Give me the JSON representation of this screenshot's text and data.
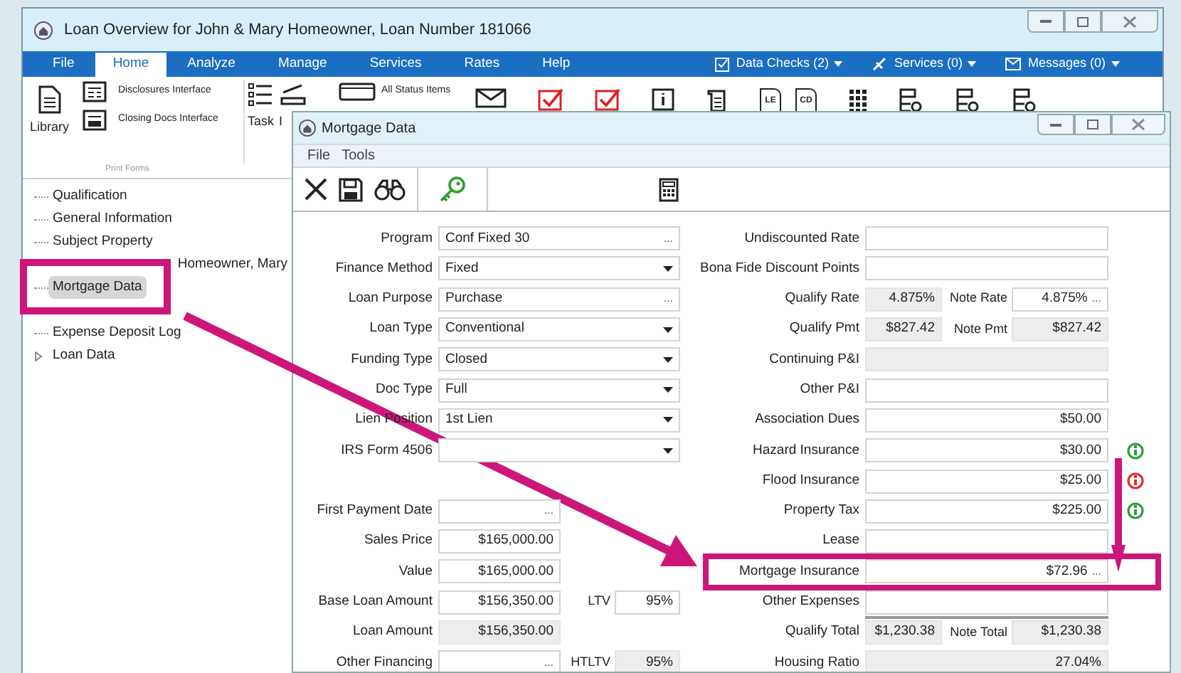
{
  "main_window": {
    "title": "Loan Overview for John & Mary Homeowner, Loan Number 181066"
  },
  "ribbon_tabs": [
    {
      "label": "File",
      "selected": false
    },
    {
      "label": "Home",
      "selected": true
    },
    {
      "label": "Analyze",
      "selected": false
    },
    {
      "label": "Manage",
      "selected": false
    },
    {
      "label": "Services",
      "selected": false
    },
    {
      "label": "Rates",
      "selected": false
    },
    {
      "label": "Help",
      "selected": false
    }
  ],
  "ribbon_menus": [
    {
      "kind": "checks",
      "label": "Data Checks (2)"
    },
    {
      "kind": "services",
      "label": "Services (0)"
    },
    {
      "kind": "messages",
      "label": "Messages (0)"
    }
  ],
  "ribbon": {
    "library": "Library",
    "disclosures": "Disclosures Interface",
    "closing_docs": "Closing Docs Interface",
    "group_label": "Print Forms",
    "task": "Task",
    "partial_label": "I",
    "status_items": "All Status Items",
    "doc_badges": [
      "LE",
      "CD"
    ]
  },
  "tree": [
    {
      "label": "Qualification",
      "selected": false
    },
    {
      "label": "General Information",
      "selected": false
    },
    {
      "label": "Subject Property",
      "selected": false
    },
    {
      "label": "Homeowner, Mary",
      "selected": false
    },
    {
      "label": "Mortgage Data",
      "selected": true
    },
    {
      "label": "Expense Deposit Log",
      "selected": false
    },
    {
      "label": "Loan Data",
      "selected": false,
      "expander": true
    }
  ],
  "mortgage_window": {
    "title": "Mortgage Data",
    "menu": [
      "File",
      "Tools"
    ]
  },
  "left_upper": [
    {
      "label": "Program",
      "value": "Conf Fixed 30",
      "kind": "picker",
      "button": "..."
    },
    {
      "label": "Finance Method",
      "value": "Fixed",
      "kind": "dropdown"
    },
    {
      "label": "Loan Purpose",
      "value": "Purchase",
      "kind": "picker",
      "button": "..."
    },
    {
      "label": "Loan Type",
      "value": "Conventional",
      "kind": "dropdown"
    },
    {
      "label": "Funding Type",
      "value": "Closed",
      "kind": "dropdown"
    },
    {
      "label": "Doc Type",
      "value": "Full",
      "kind": "dropdown"
    },
    {
      "label": "Lien Position",
      "value": "1st Lien",
      "kind": "dropdown"
    },
    {
      "label": "IRS Form 4506",
      "kind": "dropdown"
    }
  ],
  "left_lower": [
    {
      "label": "First Payment Date",
      "kind": "picker",
      "button": "..."
    },
    {
      "label": "Sales Price",
      "value": "$165,000.00",
      "kind": "text"
    },
    {
      "label": "Value",
      "value": "$165,000.00",
      "kind": "text"
    },
    {
      "label": "Base Loan Amount",
      "value": "$156,350.00",
      "kind": "text",
      "second": {
        "label": "LTV",
        "value": "95%",
        "kind": "text"
      }
    },
    {
      "label": "Loan Amount",
      "value": "$156,350.00",
      "kind": "readonly"
    },
    {
      "label": "Other Financing",
      "kind": "picker",
      "button": "...",
      "second": {
        "label": "HTLTV",
        "value": "95%",
        "kind": "readonly"
      }
    }
  ],
  "right": [
    {
      "label": "Undiscounted Rate",
      "kind": "text"
    },
    {
      "label": "Bona Fide Discount Points",
      "kind": "text"
    },
    {
      "label": "Qualify Rate",
      "value": "4.875%",
      "kind": "readonly",
      "second": {
        "label": "Note Rate",
        "value": "4.875%",
        "kind": "picker",
        "button": "..."
      }
    },
    {
      "label": "Qualify Pmt",
      "value": "$827.42",
      "kind": "readonly",
      "second": {
        "label": "Note Pmt",
        "value": "$827.42",
        "kind": "readonly"
      }
    },
    {
      "label": "Continuing P&I",
      "kind": "readonly"
    },
    {
      "label": "Other P&I",
      "kind": "text"
    },
    {
      "label": "Association Dues",
      "value": "$50.00",
      "kind": "text"
    },
    {
      "label": "Hazard Insurance",
      "value": "$30.00",
      "kind": "text",
      "color": "#2e9e3e"
    },
    {
      "label": "Flood Insurance",
      "value": "$25.00",
      "kind": "text",
      "color": "#e0302c"
    },
    {
      "label": "Property Tax",
      "value": "$225.00",
      "kind": "text",
      "color": "#2e9e3e"
    },
    {
      "label": "Lease",
      "kind": "text"
    },
    {
      "label": "Mortgage Insurance",
      "value": "$72.96",
      "kind": "picker",
      "button": "..."
    },
    {
      "label": "Other Expenses",
      "kind": "text"
    },
    {
      "label": "Qualify Total",
      "value": "$1,230.38",
      "kind": "readonly",
      "divider_above": true,
      "second": {
        "label": "Note Total",
        "value": "$1,230.38",
        "kind": "readonly"
      }
    },
    {
      "label": "Housing Ratio",
      "value": "27.04%",
      "kind": "readonly"
    }
  ]
}
